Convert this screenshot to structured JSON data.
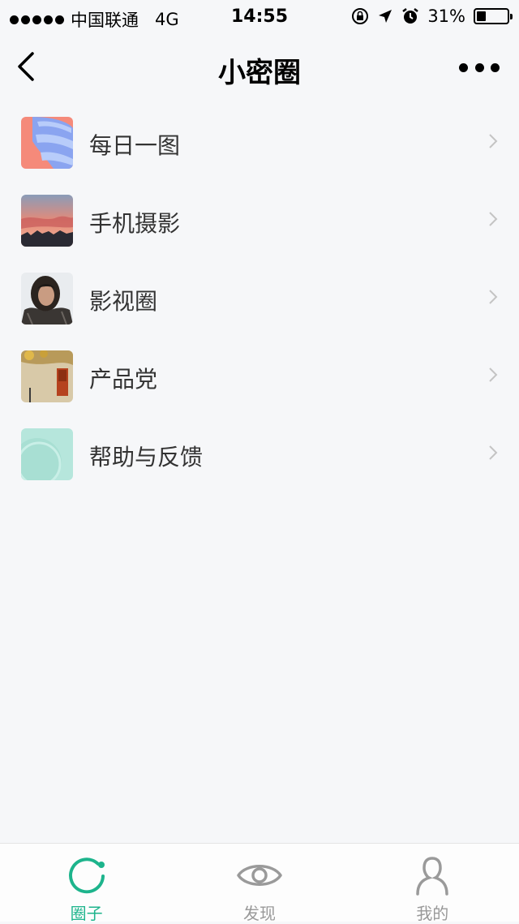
{
  "status_bar": {
    "carrier": "中国联通",
    "network": "4G",
    "time": "14:55",
    "battery": "31%",
    "battery_level": 0.31
  },
  "nav": {
    "title": "小密圈",
    "back_icon": "chevron-left-icon",
    "more_icon": "more-dots-icon"
  },
  "list": {
    "items": [
      {
        "label": "每日一图"
      },
      {
        "label": "手机摄影"
      },
      {
        "label": "影视圈"
      },
      {
        "label": "产品党"
      },
      {
        "label": "帮助与反馈"
      }
    ]
  },
  "tabs": [
    {
      "label": "圈子",
      "icon": "circle-icon",
      "active": true
    },
    {
      "label": "发现",
      "icon": "eye-icon",
      "active": false
    },
    {
      "label": "我的",
      "icon": "person-icon",
      "active": false
    }
  ],
  "colors": {
    "accent": "#1db48c",
    "background": "#f6f7f9",
    "inactive_tab": "#999999"
  }
}
